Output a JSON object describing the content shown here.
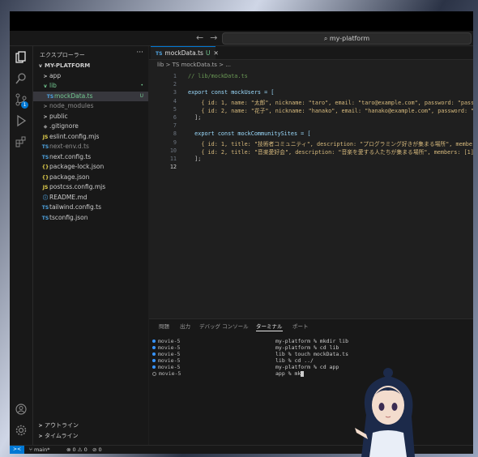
{
  "search": {
    "text": "my-platform"
  },
  "explorer": {
    "title": "エクスプローラー",
    "more": "···",
    "root": "MY-PLATFORM",
    "items": [
      {
        "label": "app",
        "kind": "folder",
        "chev": ">",
        "depth": 1,
        "color": "#cccccc"
      },
      {
        "label": "lib",
        "kind": "folder-open",
        "chev": "v",
        "depth": 1,
        "color": "#73c991",
        "status": "•"
      },
      {
        "label": "mockData.ts",
        "kind": "ts",
        "icon": "TS",
        "depth": 2,
        "color": "#73c991",
        "status": "U",
        "selected": true
      },
      {
        "label": "node_modules",
        "kind": "folder",
        "chev": ">",
        "depth": 1,
        "color": "#8b8b8b"
      },
      {
        "label": "public",
        "kind": "folder",
        "chev": ">",
        "depth": 1,
        "color": "#cccccc"
      },
      {
        "label": ".gitignore",
        "kind": "file",
        "icon": "◆",
        "depth": 1,
        "color": "#cccccc"
      },
      {
        "label": "eslint.config.mjs",
        "kind": "js",
        "icon": "JS",
        "depth": 1,
        "color": "#cccccc"
      },
      {
        "label": "next-env.d.ts",
        "kind": "ts",
        "icon": "TS",
        "depth": 1,
        "color": "#8b8b8b"
      },
      {
        "label": "next.config.ts",
        "kind": "ts",
        "icon": "TS",
        "depth": 1,
        "color": "#cccccc"
      },
      {
        "label": "package-lock.json",
        "kind": "json",
        "icon": "{}",
        "depth": 1,
        "color": "#cccccc"
      },
      {
        "label": "package.json",
        "kind": "json",
        "icon": "{}",
        "depth": 1,
        "color": "#cccccc"
      },
      {
        "label": "postcss.config.mjs",
        "kind": "js",
        "icon": "JS",
        "depth": 1,
        "color": "#cccccc"
      },
      {
        "label": "README.md",
        "kind": "md",
        "icon": "ⓘ",
        "depth": 1,
        "color": "#cccccc"
      },
      {
        "label": "tailwind.config.ts",
        "kind": "ts",
        "icon": "TS",
        "depth": 1,
        "color": "#cccccc"
      },
      {
        "label": "tsconfig.json",
        "kind": "tsconfig",
        "icon": "TS",
        "depth": 1,
        "color": "#cccccc"
      }
    ],
    "outline": "アウトライン",
    "timeline": "タイムライン"
  },
  "editor": {
    "tab": {
      "icon": "TS",
      "label": "mockData.ts",
      "status": "U",
      "close": "✕"
    },
    "breadcrumb": "lib > TS mockData.ts > ...",
    "lines": [
      {
        "n": "1",
        "t": "// lib/mockData.ts"
      },
      {
        "n": "2",
        "t": ""
      },
      {
        "n": "3",
        "t": "export const mockUsers = ["
      },
      {
        "n": "4",
        "t": "    { id: 1, name: \"太郎\", nickname: \"taro\", email: \"taro@example.com\", password: \"passw"
      },
      {
        "n": "5",
        "t": "    { id: 2, name: \"花子\", nickname: \"hanako\", email: \"hanako@example.com\", password: \"pa"
      },
      {
        "n": "6",
        "t": "  ];"
      },
      {
        "n": "7",
        "t": ""
      },
      {
        "n": "8",
        "t": "  export const mockCommunitySites = ["
      },
      {
        "n": "9",
        "t": "    { id: 1, title: \"技術者コミュニティ\", description: \"プログラミング好きが集まる場所\", members"
      },
      {
        "n": "10",
        "t": "    { id: 2, title: \"音楽愛好会\", description: \"音楽を愛する人たちが集まる場所\", members: [1] }"
      },
      {
        "n": "11",
        "t": "  ];"
      },
      {
        "n": "12",
        "t": ""
      }
    ]
  },
  "panel": {
    "tabs": [
      "問題",
      "出力",
      "デバッグ コンソール",
      "ターミナル",
      "ポート"
    ],
    "active_tab": 3,
    "terminals": [
      "movie-5",
      "movie-5",
      "movie-5",
      "movie-5",
      "movie-5",
      "movie-5"
    ],
    "output": [
      "my-platform % mkdir lib",
      "my-platform % cd lib",
      "lib % touch mockData.ts",
      "lib % cd ../",
      "my-platform % cd app",
      "app % mk"
    ]
  },
  "statusbar": {
    "remote": "><",
    "branch": "main*",
    "errors": "⊗ 0 ⚠ 0",
    "ports": "⊘ 0"
  },
  "colors": {
    "accent": "#0078d4",
    "untracked": "#73c991"
  }
}
